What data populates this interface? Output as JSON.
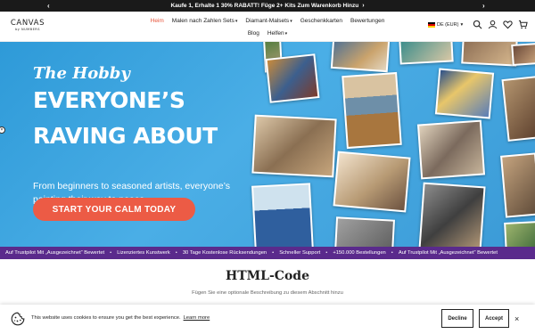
{
  "announcement": {
    "text": "Kaufe 1, Erhalte 1 30% RABATT! Füge 2+ Kits Zum Warenkorb Hinzu",
    "chevron": "›",
    "prev": "‹",
    "next": "›"
  },
  "logo": {
    "line1": "CANVAS",
    "line2": "by NUMBERS"
  },
  "nav": [
    {
      "label": "Heim",
      "caret": ""
    },
    {
      "label": "Malen nach Zahlen Sets",
      "caret": "▾"
    },
    {
      "label": "Diamant-Malsets",
      "caret": "▾"
    },
    {
      "label": "Geschenkkarten",
      "caret": ""
    },
    {
      "label": "Bewertungen",
      "caret": ""
    },
    {
      "label": "Blog",
      "caret": ""
    },
    {
      "label": "Helfen",
      "caret": "▾"
    }
  ],
  "locale": {
    "label": "DE (EUR)",
    "caret": "▾"
  },
  "header_icons": [
    "search-icon",
    "account-icon",
    "heart-icon",
    "cart-icon"
  ],
  "hero": {
    "line_small": "The Hobby",
    "line_big1": "EVERYONE’S",
    "line_big2": "RAVING ABOUT",
    "subtitle": "From beginners to seasoned artists, everyone’s painting their way to peace.",
    "cta": "START YOUR CALM TODAY",
    "edge_dot": "×"
  },
  "ticker": [
    "Auf Trustpilot Mit „Ausgezeichnet“ Bewertet",
    "Lizenziertes Kunstwerk",
    "30 Tage Kostenlose Rücksendungen",
    "Schneller Support",
    "+150.000 Bestellungen",
    "Auf Trustpilot Mit „Ausgezeichnet“ Bewertet"
  ],
  "ticker_sep": "•",
  "section": {
    "title": "HTML-Code",
    "description": "Fügen Sie eine optionale Beschreibung zu diesem Abschnitt hinzu"
  },
  "cookie": {
    "text": "This website uses cookies to ensure you get the best experience.",
    "learn_more": "Learn more",
    "decline": "Decline",
    "accept": "Accept",
    "close": "×"
  },
  "colors": {
    "accent": "#e8553b",
    "cta": "#ec5b45",
    "hero_bg": "#3b9ad6",
    "ticker_bg": "#5a2a8c",
    "announcement_bg": "#1a1a1a"
  }
}
